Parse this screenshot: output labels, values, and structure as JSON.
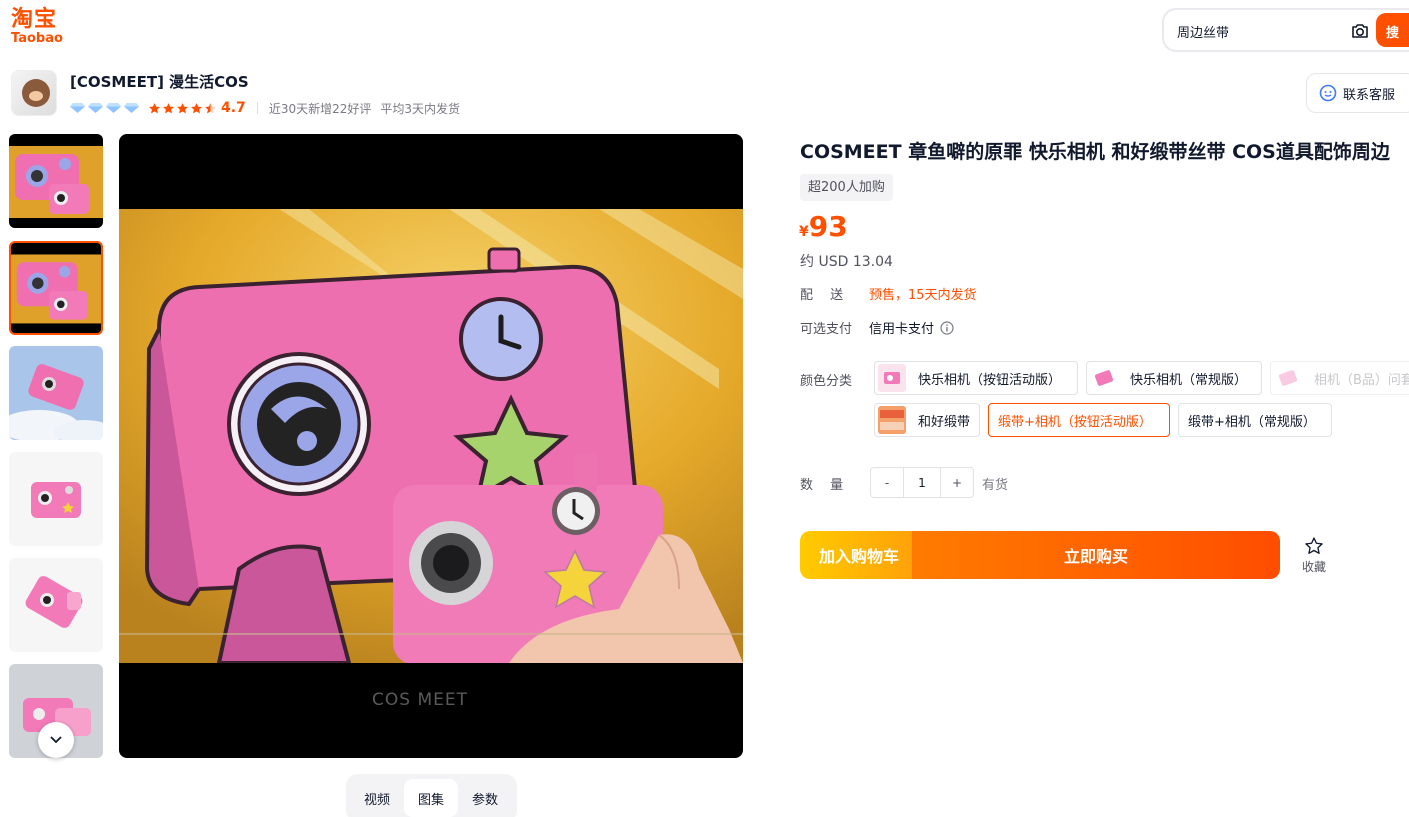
{
  "header": {
    "logo_cn": "淘宝",
    "logo_en": "Taobao",
    "search_value": "周边丝带",
    "search_button": "搜"
  },
  "store": {
    "name": "[COSMEET] 漫生活COS",
    "rating": "4.7",
    "diamonds": 4,
    "stars": 4.5,
    "recent_reviews": "近30天新增22好评",
    "avg_ship": "平均3天内发货",
    "contact": "联系客服"
  },
  "gallery": {
    "watermark": "COS  MEET",
    "tabs": [
      "视频",
      "图集",
      "参数"
    ],
    "active_tab": "图集"
  },
  "product": {
    "title": "COSMEET 章鱼噼的原罪 快乐相机 和好缎带丝带 COS道具配饰周边",
    "buyers": "超200人加购",
    "currency": "¥",
    "price": "93",
    "usd": "约 USD 13.04",
    "delivery_label": "配　 送",
    "delivery_value": "预售，15天内发货",
    "payment_label": "可选支付",
    "payment_value": "信用卡支付",
    "color_label": "颜色分类",
    "options": [
      {
        "label": "快乐相机（按钮活动版）",
        "state": "normal"
      },
      {
        "label": "快乐相机（常规版）",
        "state": "normal"
      },
      {
        "label": "相机（B品）问套",
        "state": "disabled"
      },
      {
        "label": "和好缎带",
        "state": "normal"
      },
      {
        "label": "缎带+相机（按钮活动版）",
        "state": "selected"
      },
      {
        "label": "缎带+相机（常规版）",
        "state": "normal"
      }
    ],
    "qty_label": "数　 量",
    "qty_minus": "-",
    "qty_value": "1",
    "qty_plus": "+",
    "stock": "有货",
    "cart_button": "加入购物车",
    "buy_button": "立即购买",
    "favorite": "收藏"
  },
  "colors": {
    "brand": "#ff5000",
    "camera_pink": "#ef6fb0",
    "background_yellow": "#e5a92a"
  }
}
